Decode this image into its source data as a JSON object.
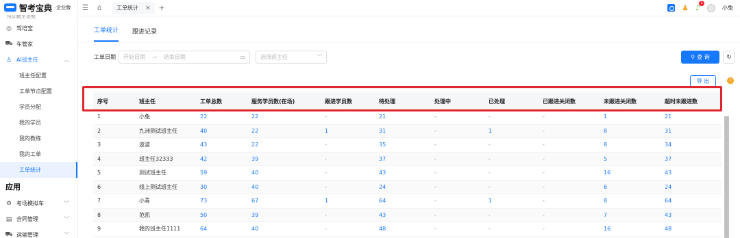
{
  "brand": {
    "name": "智考宝典",
    "edition": "·企业版",
    "cut_text": "培训截至提醒"
  },
  "sidebar": {
    "items": [
      {
        "label": "驾培宝",
        "icon": "shield-icon"
      },
      {
        "label": "车管家",
        "icon": "car-icon"
      }
    ],
    "parent": {
      "label": "AI班主任",
      "icon": "user-icon"
    },
    "sub_items": [
      "班主任配置",
      "工单节点配置",
      "学员分配",
      "我的学员",
      "我的教练",
      "我的工单",
      "工单统计"
    ],
    "active_sub": "工单统计",
    "section": "应用",
    "apps": [
      {
        "label": "考场模拟车",
        "icon": "gear-icon"
      },
      {
        "label": "合同管理",
        "icon": "document-icon"
      },
      {
        "label": "运输管理",
        "icon": "truck-icon"
      }
    ]
  },
  "topbar": {
    "tab_label": "工单统计",
    "user_name": "小兔",
    "badge": "1"
  },
  "subtabs": [
    "工单统计",
    "跟进记录"
  ],
  "filter": {
    "label": "工单日期",
    "start_placeholder": "开始日期",
    "arrow": "→",
    "end_placeholder": "结束日期",
    "select_placeholder": "选择班主任",
    "query": "查 询",
    "export": "导 出"
  },
  "table": {
    "headers": [
      "序号",
      "班主任",
      "工单总数",
      "服务学员数(在场)",
      "跟进学员数",
      "待处理",
      "处理中",
      "已处理",
      "已跟进关闭数",
      "未跟进关闭数",
      "超时未跟进数"
    ],
    "rows": [
      [
        "1",
        "小兔",
        "22",
        "22",
        "-",
        "21",
        "-",
        "-",
        "-",
        "1",
        "21"
      ],
      [
        "2",
        "九洲测试班主任",
        "40",
        "22",
        "1",
        "31",
        "-",
        "1",
        "-",
        "8",
        "31"
      ],
      [
        "3",
        "波波",
        "43",
        "22",
        "-",
        "35",
        "-",
        "-",
        "-",
        "8",
        "34"
      ],
      [
        "4",
        "班主任32333",
        "42",
        "39",
        "-",
        "37",
        "-",
        "-",
        "-",
        "5",
        "37"
      ],
      [
        "5",
        "测试班主任",
        "59",
        "40",
        "-",
        "43",
        "-",
        "-",
        "-",
        "16",
        "43"
      ],
      [
        "6",
        "线上测试班主任",
        "30",
        "40",
        "-",
        "24",
        "-",
        "-",
        "-",
        "6",
        "24"
      ],
      [
        "7",
        "小青",
        "73",
        "67",
        "1",
        "64",
        "-",
        "1",
        "-",
        "8",
        "64"
      ],
      [
        "8",
        "范凯",
        "50",
        "39",
        "-",
        "43",
        "-",
        "-",
        "-",
        "7",
        "43"
      ],
      [
        "9",
        "我的班主任1111",
        "64",
        "40",
        "-",
        "48",
        "-",
        "-",
        "-",
        "16",
        "48"
      ]
    ]
  },
  "colors": {
    "accent": "#1677ff",
    "highlight": "#e0242b"
  }
}
